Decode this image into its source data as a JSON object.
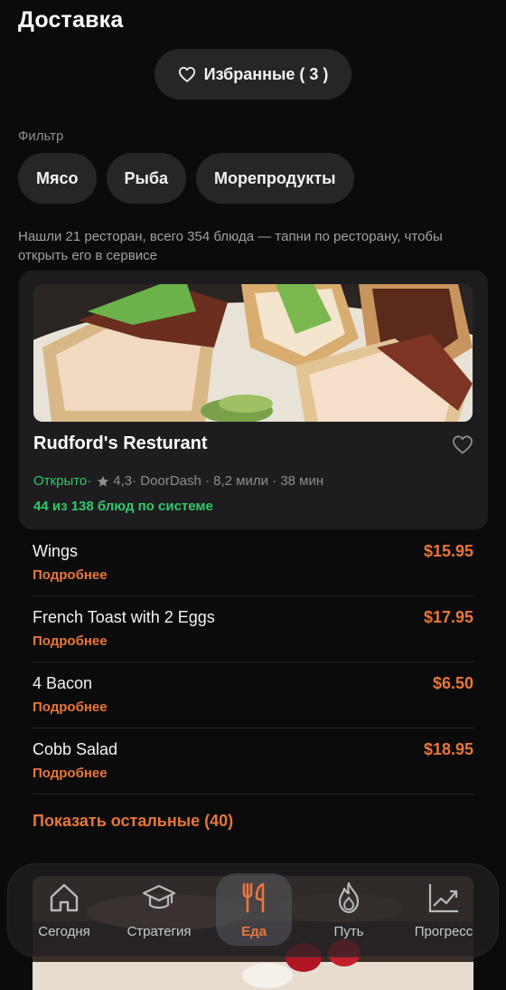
{
  "header": {
    "title": "Доставка"
  },
  "favorites": {
    "label": "Избранные ( 3 )"
  },
  "filter": {
    "label": "Фильтр",
    "chips": [
      "Мясо",
      "Рыба",
      "Морепродукты"
    ]
  },
  "summary": "Нашли 21 ресторан, всего 354 блюда — тапни по ресторану, чтобы открыть его в сервисе",
  "restaurant": {
    "name": "Rudford's Resturant",
    "status": "Открыто",
    "sep1": " · ",
    "rating": "4,3",
    "details": " · DoorDash · 8,2 мили · 38 мин",
    "dishes_match": "44 из 138 блюд по системе"
  },
  "dishes": [
    {
      "name": "Wings",
      "more": "Подробнее",
      "price": "$15.95"
    },
    {
      "name": "French Toast with 2 Eggs",
      "more": "Подробнее",
      "price": "$17.95"
    },
    {
      "name": "4 Bacon",
      "more": "Подробнее",
      "price": "$6.50"
    },
    {
      "name": "Cobb Salad",
      "more": "Подробнее",
      "price": "$18.95"
    }
  ],
  "show_rest": "Показать остальные (40)",
  "tabbar": {
    "tabs": [
      {
        "label": "Сегодня",
        "icon": "home-icon"
      },
      {
        "label": "Стратегия",
        "icon": "graduation-cap-icon"
      },
      {
        "label": "Еда",
        "icon": "fork-knife-icon",
        "active": true
      },
      {
        "label": "Путь",
        "icon": "flame-icon"
      },
      {
        "label": "Прогресс",
        "icon": "trend-chart-icon"
      }
    ]
  },
  "colors": {
    "accent": "#e8763a",
    "open_green": "#33c76a",
    "background": "#0b0b0c",
    "card": "#1d1d20",
    "chip": "#262628"
  }
}
